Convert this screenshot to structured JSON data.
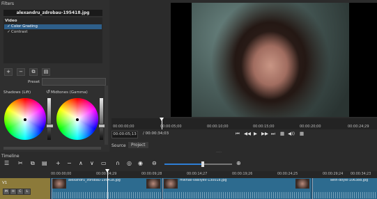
{
  "filters": {
    "title": "Filters",
    "clip_name": "alexandru_zdrobau-195418.jpg",
    "group_label": "Video",
    "items": [
      {
        "check": "✓",
        "label": "Color Grading",
        "selected": true
      },
      {
        "check": "✓",
        "label": "Contrast",
        "selected": false
      }
    ],
    "toolbar": {
      "add": "+",
      "remove": "−",
      "copy": "⧉",
      "paste": "▤"
    },
    "preset_label": "Preset",
    "preset_value": "",
    "shadows_label": "Shadows (Lift)",
    "midtones_label": "Midtones (Gamma)",
    "reset_icon": "↺"
  },
  "player": {
    "ruler_ticks": [
      "00:00:00;00",
      "00:00:05;00",
      "00:00:10;00",
      "00:00:15;00",
      "00:00:20;00",
      "00:00:24;29"
    ],
    "timecode_current": "00:00:05;13",
    "timecode_total": "/ 00:00:34;03",
    "controls": {
      "to_start": "⏮",
      "rewind": "◀◀",
      "play": "▶",
      "forward": "▶▶",
      "to_end": "⏭",
      "loop": "▦",
      "volume": "◀))",
      "grid": "▦"
    },
    "tabs": {
      "source": "Source",
      "project": "Project"
    },
    "grip": "....."
  },
  "timeline": {
    "title": "Timeline",
    "tools": {
      "menu": "☰",
      "cut": "✂",
      "copy": "⧉",
      "paste": "▤",
      "append": "+",
      "remove": "−",
      "lift": "∧",
      "overwrite": "∨",
      "split": "▭",
      "snap": "∩",
      "ripple": "◎",
      "ripple_all": "◉",
      "zoom_out": "⊖",
      "zoom_in": "⊕"
    },
    "zoom_level": 0.57,
    "ruler_ticks": [
      "00:00:00;00",
      "00:00:04;29",
      "00:00:09;28",
      "00:00:14;27",
      "00:00:19;26",
      "00:00:24;25",
      "00:00:29;24",
      "00:00:34;23"
    ],
    "track": {
      "name": "V1",
      "buttons": [
        "M",
        "H",
        "C",
        "L"
      ]
    },
    "clips": [
      {
        "name": "alexandru_zdrobau-195418.jpg"
      },
      {
        "name": "mikhail-vasilyev-130018.jpg"
      },
      {
        "name": "seth-doyle-106388.jpg"
      }
    ]
  }
}
